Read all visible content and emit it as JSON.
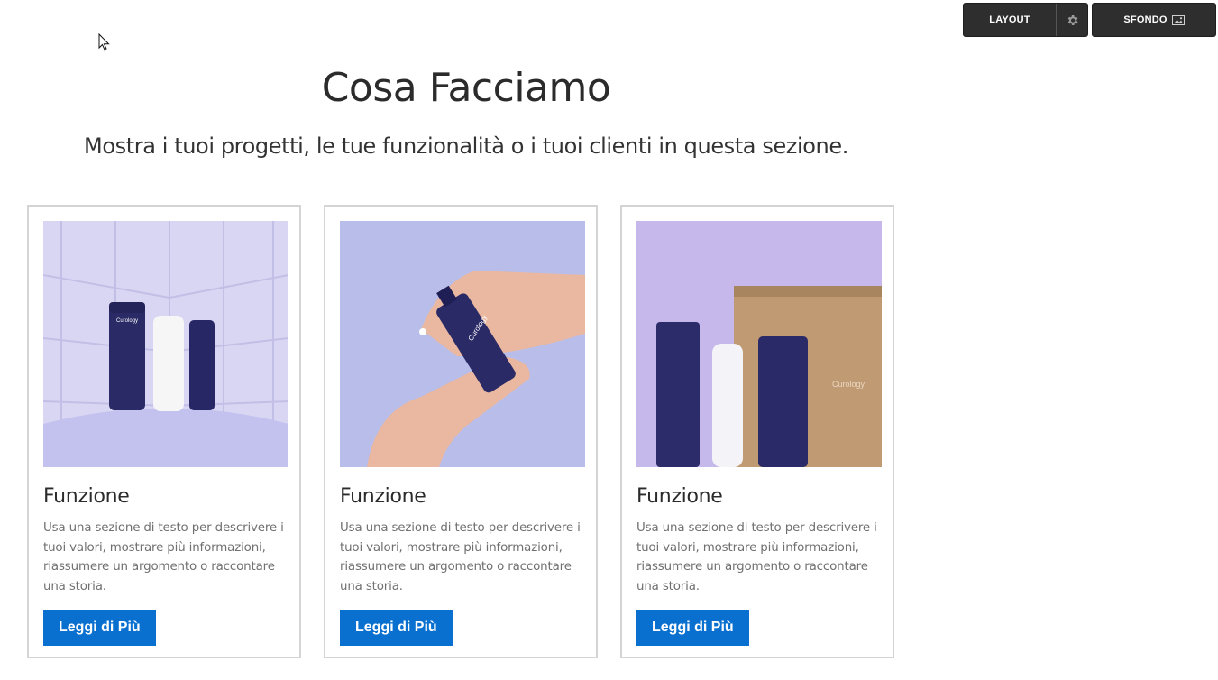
{
  "toolbar": {
    "layout_label": "LAYOUT",
    "settings_icon": "gear-icon",
    "background_label": "SFONDO",
    "background_icon": "image-icon"
  },
  "section": {
    "title": "Cosa Facciamo",
    "subtitle": "Mostra i tuoi progetti, le tue funzionalità o i tuoi clienti in questa sezione."
  },
  "cards": [
    {
      "image_brand": "Curology",
      "title": "Funzione",
      "text": "Usa una sezione di testo per descrivere i tuoi valori, mostrare più informazioni, riassumere un argomento o raccontare una storia.",
      "button_label": "Leggi di Più"
    },
    {
      "image_brand": "Curology",
      "title": "Funzione",
      "text": "Usa una sezione di testo per descrivere i tuoi valori, mostrare più informazioni, riassumere un argomento o raccontare una storia.",
      "button_label": "Leggi di Più"
    },
    {
      "image_brand": "Curology",
      "title": "Funzione",
      "text": "Usa una sezione di testo per descrivere i tuoi valori, mostrare più informazioni, riassumere un argomento o raccontare una storia.",
      "button_label": "Leggi di Più"
    }
  ],
  "colors": {
    "button": "#0a70d0",
    "toolbar": "#2e2e2e",
    "card_border": "#d4d4d4",
    "photo_background": "#c9c5ee"
  }
}
